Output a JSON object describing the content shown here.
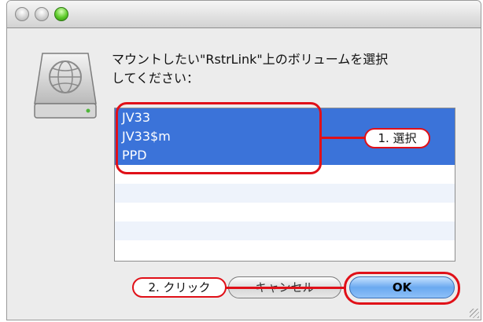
{
  "window": {
    "traffic_lights": [
      "close",
      "minimize",
      "zoom"
    ]
  },
  "dialog": {
    "icon": "network-drive-icon",
    "prompt_line1": "マウントしたい\"RstrLink\"上のボリュームを選択",
    "prompt_line2": "してください："
  },
  "volumes": {
    "items": [
      "JV33",
      "JV33$m",
      "PPD"
    ],
    "selected": [
      "JV33",
      "JV33$m",
      "PPD"
    ],
    "empty_rows": 5
  },
  "annotations": {
    "step1": "1. 選択",
    "step2": "2. クリック"
  },
  "buttons": {
    "cancel": "キャンセル",
    "ok": "OK"
  },
  "colors": {
    "selection": "#3b73d9",
    "annotation": "#e01018",
    "default_button": "#6aa9f0"
  }
}
